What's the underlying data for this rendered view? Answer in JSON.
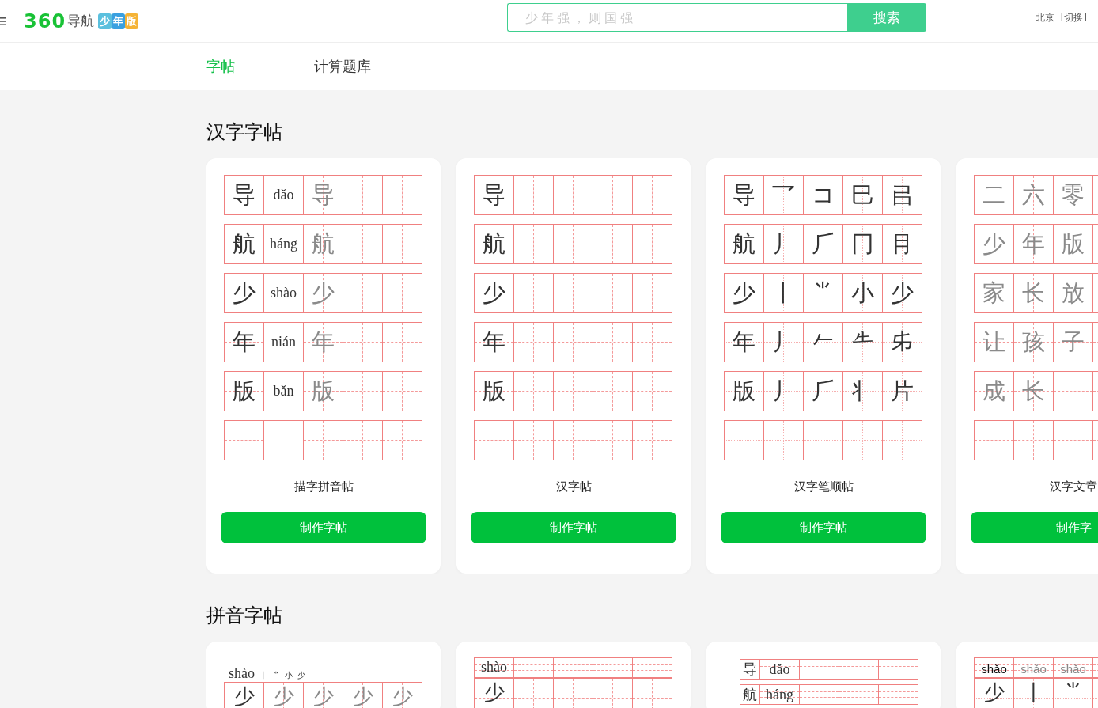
{
  "header": {
    "logo": {
      "brand": "360",
      "name": "导航",
      "badge": [
        "少",
        "年",
        "版"
      ]
    },
    "search": {
      "placeholder": "少年强，则国强",
      "button": "搜索"
    },
    "city": "北京",
    "switch": "[切换]"
  },
  "tabs": [
    {
      "label": "字帖",
      "selected": true
    },
    {
      "label": "计算题库",
      "selected": false
    }
  ],
  "sections": [
    {
      "title": "汉字字帖",
      "cards": [
        {
          "kind": "dashed",
          "title": "描字拼音帖",
          "button": "制作字帖",
          "rows": [
            {
              "kind": "tian",
              "cells": [
                {
                  "kind": "char",
                  "text": "导",
                  "faded": false
                },
                {
                  "kind": "pinyin",
                  "text": "dǎo"
                },
                {
                  "kind": "char",
                  "text": "导",
                  "faded": true
                }
              ]
            },
            {
              "kind": "tian",
              "cells": [
                {
                  "kind": "char",
                  "text": "航",
                  "faded": false
                },
                {
                  "kind": "pinyin",
                  "text": "háng"
                },
                {
                  "kind": "char",
                  "text": "航",
                  "faded": true
                }
              ]
            },
            {
              "kind": "tian",
              "cells": [
                {
                  "kind": "char",
                  "text": "少",
                  "faded": false
                },
                {
                  "kind": "pinyin",
                  "text": "shào"
                },
                {
                  "kind": "char",
                  "text": "少",
                  "faded": true
                }
              ]
            },
            {
              "kind": "tian",
              "cells": [
                {
                  "kind": "char",
                  "text": "年",
                  "faded": false
                },
                {
                  "kind": "pinyin",
                  "text": "nián"
                },
                {
                  "kind": "char",
                  "text": "年",
                  "faded": true
                }
              ]
            },
            {
              "kind": "tian",
              "cells": [
                {
                  "kind": "char",
                  "text": "版",
                  "faded": false
                },
                {
                  "kind": "pinyin",
                  "text": "bǎn"
                },
                {
                  "kind": "char",
                  "text": "版",
                  "faded": true
                }
              ]
            },
            {
              "kind": "tian",
              "cells": [
                {
                  "kind": "blank"
                },
                {
                  "kind": "plain"
                }
              ]
            }
          ]
        },
        {
          "kind": "dashed",
          "title": "汉字帖",
          "button": "制作字帖",
          "rows": [
            {
              "kind": "tian",
              "cells": [
                {
                  "kind": "char",
                  "text": "导",
                  "faded": false
                }
              ]
            },
            {
              "kind": "tian",
              "cells": [
                {
                  "kind": "char",
                  "text": "航",
                  "faded": false
                }
              ]
            },
            {
              "kind": "tian",
              "cells": [
                {
                  "kind": "char",
                  "text": "少",
                  "faded": false
                }
              ]
            },
            {
              "kind": "tian",
              "cells": [
                {
                  "kind": "char",
                  "text": "年",
                  "faded": false
                }
              ]
            },
            {
              "kind": "tian",
              "cells": [
                {
                  "kind": "char",
                  "text": "版",
                  "faded": false
                }
              ]
            },
            {
              "kind": "tian"
            }
          ]
        },
        {
          "kind": "dotted",
          "title": "汉字笔顺帖",
          "button": "制作字帖",
          "rows": [
            {
              "kind": "tian",
              "cells": [
                {
                  "kind": "char",
                  "text": "导",
                  "faded": false
                },
                {
                  "kind": "char",
                  "text": "乛",
                  "faded": false
                },
                {
                  "kind": "char",
                  "text": "コ",
                  "faded": false
                },
                {
                  "kind": "char",
                  "text": "巳",
                  "faded": false
                },
                {
                  "kind": "char",
                  "text": "㠯",
                  "faded": false
                }
              ]
            },
            {
              "kind": "tian",
              "cells": [
                {
                  "kind": "char",
                  "text": "航",
                  "faded": false
                },
                {
                  "kind": "char",
                  "text": "丿",
                  "faded": false
                },
                {
                  "kind": "char",
                  "text": "⺁",
                  "faded": false
                },
                {
                  "kind": "char",
                  "text": "冂",
                  "faded": false
                },
                {
                  "kind": "char",
                  "text": "⺝",
                  "faded": false
                }
              ]
            },
            {
              "kind": "tian",
              "cells": [
                {
                  "kind": "char",
                  "text": "少",
                  "faded": false
                },
                {
                  "kind": "char",
                  "text": "丨",
                  "faded": false
                },
                {
                  "kind": "char",
                  "text": "⺌",
                  "faded": false
                },
                {
                  "kind": "char",
                  "text": "小",
                  "faded": false
                },
                {
                  "kind": "char",
                  "text": "少",
                  "faded": false
                }
              ]
            },
            {
              "kind": "tian",
              "cells": [
                {
                  "kind": "char",
                  "text": "年",
                  "faded": false
                },
                {
                  "kind": "char",
                  "text": "丿",
                  "faded": false
                },
                {
                  "kind": "char",
                  "text": "𠂉",
                  "faded": false
                },
                {
                  "kind": "char",
                  "text": "𠂒",
                  "faded": false
                },
                {
                  "kind": "char",
                  "text": "𠂔",
                  "faded": false
                }
              ]
            },
            {
              "kind": "tian",
              "cells": [
                {
                  "kind": "char",
                  "text": "版",
                  "faded": false
                },
                {
                  "kind": "char",
                  "text": "丿",
                  "faded": false
                },
                {
                  "kind": "char",
                  "text": "⺁",
                  "faded": false
                },
                {
                  "kind": "char",
                  "text": "⺦",
                  "faded": false
                },
                {
                  "kind": "char",
                  "text": "片",
                  "faded": false
                }
              ]
            },
            {
              "kind": "tian"
            }
          ]
        },
        {
          "kind": "dashed",
          "title": "汉字文章",
          "button": "制作字",
          "rows": [
            {
              "kind": "tian",
              "cells": [
                {
                  "kind": "char",
                  "text": "二",
                  "faded": true
                },
                {
                  "kind": "char",
                  "text": "六",
                  "faded": true
                },
                {
                  "kind": "char",
                  "text": "零",
                  "faded": true
                }
              ]
            },
            {
              "kind": "tian",
              "cells": [
                {
                  "kind": "char",
                  "text": "少",
                  "faded": true
                },
                {
                  "kind": "char",
                  "text": "年",
                  "faded": true
                },
                {
                  "kind": "char",
                  "text": "版",
                  "faded": true
                }
              ]
            },
            {
              "kind": "tian",
              "cells": [
                {
                  "kind": "char",
                  "text": "家",
                  "faded": true
                },
                {
                  "kind": "char",
                  "text": "长",
                  "faded": true
                },
                {
                  "kind": "char",
                  "text": "放",
                  "faded": true
                }
              ]
            },
            {
              "kind": "tian",
              "cells": [
                {
                  "kind": "char",
                  "text": "让",
                  "faded": true
                },
                {
                  "kind": "char",
                  "text": "孩",
                  "faded": true
                },
                {
                  "kind": "char",
                  "text": "子",
                  "faded": true
                }
              ]
            },
            {
              "kind": "tian",
              "cells": [
                {
                  "kind": "char",
                  "text": "成",
                  "faded": true
                },
                {
                  "kind": "char",
                  "text": "长",
                  "faded": true
                }
              ]
            },
            {
              "kind": "tian"
            }
          ]
        }
      ]
    },
    {
      "title": "拼音字帖",
      "cards": [
        {
          "kind": "dashed",
          "caption": {
            "pinyin": "shào",
            "strokes": [
              "丨",
              "⺌",
              "小",
              "少"
            ]
          },
          "rows": [
            {
              "kind": "tian",
              "cells": [
                {
                  "kind": "char",
                  "text": "少",
                  "faded": false
                },
                {
                  "kind": "char",
                  "text": "少",
                  "faded": true
                },
                {
                  "kind": "char",
                  "text": "少",
                  "faded": true
                },
                {
                  "kind": "char",
                  "text": "少",
                  "faded": true
                },
                {
                  "kind": "char",
                  "text": "少",
                  "faded": true
                }
              ]
            }
          ]
        },
        {
          "kind": "dashed",
          "rows": [
            {
              "kind": "lines",
              "cells": [
                {
                  "kind": "pinyin",
                  "text": "shào"
                }
              ]
            },
            {
              "kind": "tian",
              "cells": [
                {
                  "kind": "char",
                  "text": "少",
                  "faded": false
                }
              ]
            }
          ]
        },
        {
          "kind": "dashed",
          "rows": [
            {
              "kind": "compact",
              "cells": [
                {
                  "kind": "char",
                  "text": "导",
                  "faded": false
                },
                {
                  "kind": "pinyin",
                  "text": "dǎo"
                }
              ]
            },
            {
              "kind": "compact",
              "cells": [
                {
                  "kind": "char",
                  "text": "航",
                  "faded": false
                },
                {
                  "kind": "pinyin",
                  "text": "háng"
                }
              ]
            }
          ]
        },
        {
          "kind": "dotted",
          "rows": [
            {
              "kind": "lines",
              "cells": [
                {
                  "kind": "sans",
                  "text": "shǎo",
                  "faded": false
                },
                {
                  "kind": "sans",
                  "text": "shǎo",
                  "faded": true
                },
                {
                  "kind": "sans",
                  "text": "shǎo",
                  "faded": true
                }
              ]
            },
            {
              "kind": "tian",
              "cells": [
                {
                  "kind": "char",
                  "text": "少",
                  "faded": false
                },
                {
                  "kind": "char",
                  "text": "丨",
                  "faded": false
                },
                {
                  "kind": "char",
                  "text": "⺌",
                  "faded": false
                }
              ]
            }
          ]
        }
      ]
    }
  ]
}
